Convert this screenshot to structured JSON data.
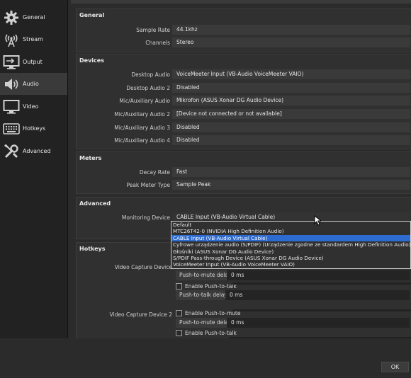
{
  "sidebar": {
    "items": [
      {
        "label": "General",
        "icon": "gear-icon"
      },
      {
        "label": "Stream",
        "icon": "antenna-icon"
      },
      {
        "label": "Output",
        "icon": "monitor-icon"
      },
      {
        "label": "Audio",
        "icon": "speaker-icon"
      },
      {
        "label": "Video",
        "icon": "display-icon"
      },
      {
        "label": "Hotkeys",
        "icon": "keyboard-icon"
      },
      {
        "label": "Advanced",
        "icon": "wrench-icon"
      }
    ],
    "active": "Audio"
  },
  "general": {
    "title": "General",
    "sample_rate_label": "Sample Rate",
    "sample_rate_value": "44.1khz",
    "channels_label": "Channels",
    "channels_value": "Stereo"
  },
  "devices": {
    "title": "Devices",
    "rows": [
      {
        "label": "Desktop Audio",
        "value": "VoiceMeeter Input (VB-Audio VoiceMeeter VAIO)"
      },
      {
        "label": "Desktop Audio 2",
        "value": "Disabled"
      },
      {
        "label": "Mic/Auxiliary Audio",
        "value": "Mikrofon (ASUS Xonar DG Audio Device)"
      },
      {
        "label": "Mic/Auxiliary Audio 2",
        "value": "[Device not connected or not available]"
      },
      {
        "label": "Mic/Auxiliary Audio 3",
        "value": "Disabled"
      },
      {
        "label": "Mic/Auxiliary Audio 4",
        "value": "Disabled"
      }
    ]
  },
  "meters": {
    "title": "Meters",
    "decay_rate_label": "Decay Rate",
    "decay_rate_value": "Fast",
    "peak_meter_label": "Peak Meter Type",
    "peak_meter_value": "Sample Peak"
  },
  "advanced": {
    "title": "Advanced",
    "monitoring_label": "Monitoring Device",
    "monitoring_value": "CABLE Input (VB-Audio Virtual Cable)",
    "dropdown_options": [
      "Default",
      "MTC26T42-0 (NVIDIA High Definition Audio)",
      "CABLE Input (VB-Audio Virtual Cable)",
      "Cyfrowe urządzenie audio (S/PDIF) (Urządzenie zgodne ze standardem High Definition Audio)",
      "Głośniki (ASUS Xonar DG Audio Device)",
      "S/PDIF Pass-through Device (ASUS Xonar DG Audio Device)",
      "VoiceMeeter Input (VB-Audio VoiceMeeter VAIO)"
    ],
    "dropdown_selected_index": 2
  },
  "hotkeys": {
    "title": "Hotkeys",
    "device1_label": "Video Capture Device",
    "ptm_delay_label": "Push-to-mute delay",
    "ptm_delay_value": "0 ms",
    "enable_ptt_label": "Enable Push-to-talk",
    "ptt_delay_label": "Push-to-talk delay",
    "ptt_delay_value": "0 ms",
    "device2_label": "Video Capture Device 2",
    "enable_ptm_label": "Enable Push-to-mute",
    "ptm_delay2_label": "Push-to-mute delay",
    "ptm_delay2_value": "0 ms",
    "enable_ptt2_label": "Enable Push-to-talk"
  },
  "footer": {
    "ok_label": "OK"
  },
  "colors": {
    "selection": "#2d6bd1",
    "background": "#2b2b2b",
    "panel": "#303030"
  }
}
